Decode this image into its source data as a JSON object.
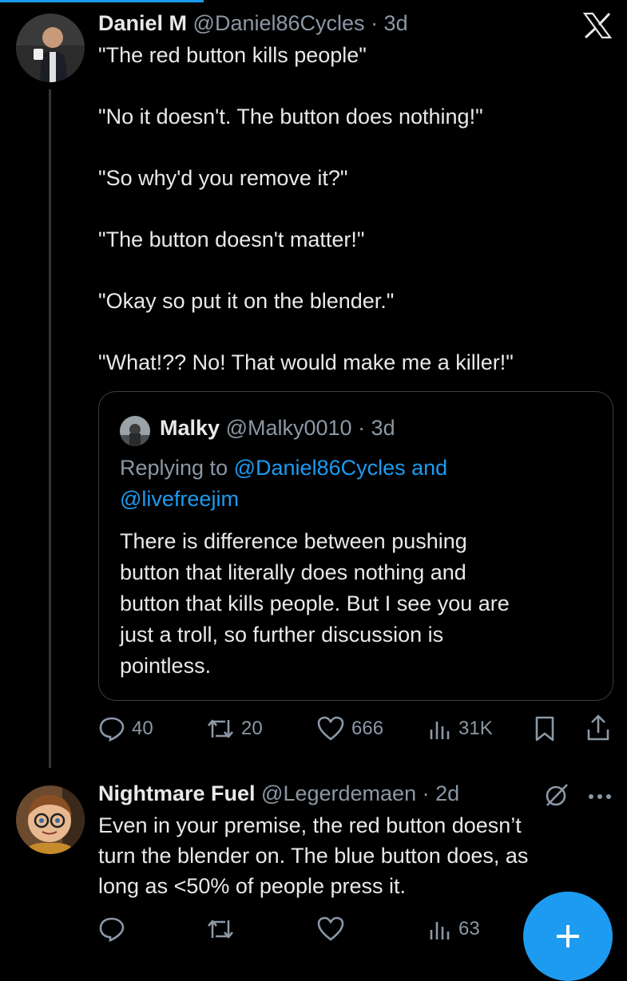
{
  "tweet": {
    "author": "Daniel M",
    "handle": "@Daniel86Cycles",
    "time": "· 3d",
    "lines": [
      "\"The red button kills people\"",
      "\"No it doesn't. The button does nothing!\"",
      "\"So why'd you remove it?\"",
      "\"The button doesn't matter!\"",
      "\"Okay so put it on the blender.\"",
      "\"What!?? No! That would make me a killer!\""
    ],
    "quote": {
      "author": "Malky",
      "handle": "@Malky0010",
      "time": "· 3d",
      "replying_prefix": "Replying to",
      "reply_target_1": "@Daniel86Cycles and",
      "reply_target_2": "@livefreejim",
      "text_lines": [
        "There is difference between pushing",
        "button that literally does nothing and",
        "button that kills people. But I see you are",
        "just a troll, so further discussion is",
        "pointless."
      ]
    },
    "stats": {
      "replies": "40",
      "reposts": "20",
      "likes": "666",
      "views": "31K"
    }
  },
  "reply": {
    "author": "Nightmare Fuel",
    "handle": "@Legerdemaen",
    "time": "· 2d",
    "lines": [
      "Even in your premise, the red button doesn’t",
      "turn the blender on. The blue button does, as",
      "long as <50% of people press it."
    ],
    "stats": {
      "views": "63"
    }
  },
  "icons": {
    "close": "x-logo-icon",
    "more": "more-icon",
    "grok": "grok-icon",
    "compose": "plus-icon"
  },
  "colors": {
    "accent": "#1d9bf0",
    "muted": "#8b98a5",
    "text": "#e7e9ea",
    "background": "#000000"
  }
}
